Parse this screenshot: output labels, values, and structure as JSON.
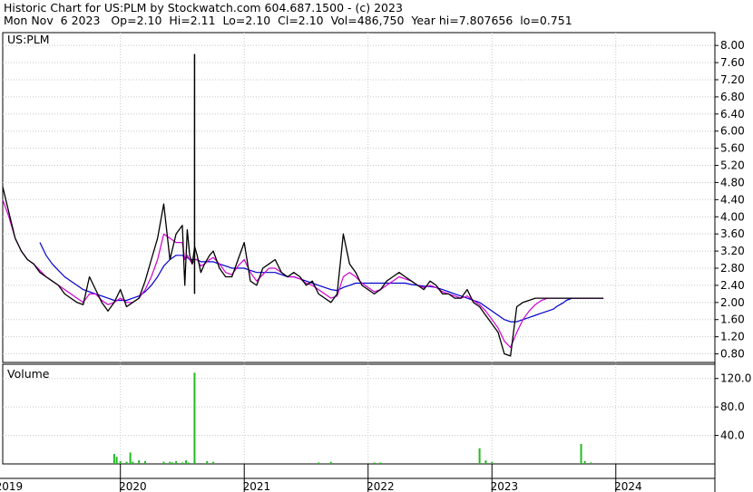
{
  "header": {
    "line1": "Historic Chart for US:PLM by Stockwatch.com 604.687.1500 - (c) 2023",
    "line2": "Mon Nov  6 2023   Op=2.10  Hi=2.11  Lo=2.10  Cl=2.10  Vol=486,750  Year hi=7.807656  lo=0.751"
  },
  "colors": {
    "price": "#000000",
    "ma_short": "#d000d0",
    "ma_long": "#0000cc",
    "volume": "#22bb22",
    "grid": "#c8c8c8"
  },
  "chart_data": [
    {
      "type": "line",
      "name_label": "US:PLM",
      "ylim": [
        0.6,
        8.3
      ],
      "y_ticks": [
        "0.80",
        "1.20",
        "1.60",
        "2.00",
        "2.40",
        "2.80",
        "3.20",
        "3.60",
        "4.00",
        "4.40",
        "4.80",
        "5.20",
        "5.60",
        "6.00",
        "6.40",
        "6.80",
        "7.20",
        "7.60",
        "8.00"
      ],
      "x_range": [
        2018.55,
        2024.3
      ],
      "x": [
        2018.55,
        2018.6,
        2018.65,
        2018.7,
        2018.75,
        2018.8,
        2018.85,
        2018.9,
        2018.95,
        2019.0,
        2019.05,
        2019.1,
        2019.15,
        2019.2,
        2019.25,
        2019.3,
        2019.35,
        2019.4,
        2019.45,
        2019.5,
        2019.55,
        2019.6,
        2019.65,
        2019.7,
        2019.75,
        2019.8,
        2019.85,
        2019.9,
        2019.95,
        2020.0,
        2020.02,
        2020.04,
        2020.06,
        2020.08,
        2020.1,
        2020.12,
        2020.15,
        2020.18,
        2020.2,
        2020.22,
        2020.25,
        2020.3,
        2020.35,
        2020.4,
        2020.45,
        2020.5,
        2020.55,
        2020.6,
        2020.65,
        2020.7,
        2020.75,
        2020.8,
        2020.85,
        2020.9,
        2020.95,
        2021.0,
        2021.05,
        2021.1,
        2021.15,
        2021.2,
        2021.25,
        2021.3,
        2021.35,
        2021.4,
        2021.45,
        2021.5,
        2021.55,
        2021.6,
        2021.65,
        2021.7,
        2021.75,
        2021.8,
        2021.85,
        2021.9,
        2021.95,
        2022.0,
        2022.05,
        2022.1,
        2022.15,
        2022.2,
        2022.25,
        2022.3,
        2022.35,
        2022.4,
        2022.45,
        2022.5,
        2022.55,
        2022.6,
        2022.65,
        2022.7,
        2022.75,
        2022.8,
        2022.85,
        2022.9,
        2022.95,
        2023.0,
        2023.02,
        2023.05,
        2023.08,
        2023.1,
        2023.13,
        2023.15,
        2023.18,
        2023.2,
        2023.25,
        2023.3,
        2023.35,
        2023.4
      ],
      "series": [
        {
          "key": "price",
          "values": [
            4.7,
            4.1,
            3.5,
            3.2,
            3.0,
            2.9,
            2.7,
            2.6,
            2.5,
            2.4,
            2.2,
            2.1,
            2.0,
            1.95,
            2.6,
            2.3,
            2.0,
            1.8,
            2.0,
            2.3,
            1.9,
            2.0,
            2.1,
            2.5,
            3.0,
            3.5,
            4.3,
            3.0,
            3.6,
            3.8,
            2.4,
            3.7,
            3.1,
            2.9,
            3.3,
            3.1,
            2.7,
            2.9,
            3.0,
            3.1,
            3.2,
            2.8,
            2.6,
            2.6,
            3.0,
            3.4,
            2.5,
            2.4,
            2.8,
            2.9,
            3.0,
            2.7,
            2.6,
            2.7,
            2.6,
            2.4,
            2.5,
            2.2,
            2.1,
            2.0,
            2.2,
            3.6,
            2.9,
            2.7,
            2.4,
            2.3,
            2.2,
            2.3,
            2.5,
            2.6,
            2.7,
            2.6,
            2.5,
            2.4,
            2.3,
            2.5,
            2.4,
            2.2,
            2.2,
            2.1,
            2.1,
            2.3,
            2.0,
            1.9,
            1.7,
            1.5,
            1.3,
            0.8,
            0.75,
            1.9,
            2.0,
            2.05,
            2.1,
            2.1,
            2.1,
            2.1,
            2.1,
            2.1,
            2.1,
            2.1,
            2.1,
            2.1,
            2.1,
            2.1,
            2.1,
            2.1,
            2.1,
            2.1
          ]
        },
        {
          "key": "ma_short",
          "values": [
            4.4,
            4.0,
            3.5,
            3.2,
            3.0,
            2.9,
            2.75,
            2.6,
            2.5,
            2.4,
            2.3,
            2.2,
            2.1,
            2.0,
            2.2,
            2.2,
            2.05,
            1.95,
            2.0,
            2.1,
            2.0,
            2.0,
            2.1,
            2.3,
            2.6,
            3.0,
            3.6,
            3.5,
            3.4,
            3.4,
            3.0,
            3.1,
            3.0,
            2.9,
            3.0,
            3.0,
            2.85,
            2.9,
            2.95,
            3.0,
            3.05,
            2.9,
            2.7,
            2.65,
            2.85,
            3.0,
            2.7,
            2.5,
            2.65,
            2.8,
            2.8,
            2.7,
            2.6,
            2.6,
            2.55,
            2.45,
            2.4,
            2.3,
            2.2,
            2.1,
            2.15,
            2.6,
            2.7,
            2.6,
            2.45,
            2.35,
            2.25,
            2.3,
            2.4,
            2.5,
            2.6,
            2.55,
            2.5,
            2.4,
            2.35,
            2.4,
            2.35,
            2.25,
            2.2,
            2.15,
            2.1,
            2.15,
            2.05,
            1.95,
            1.8,
            1.6,
            1.4,
            1.1,
            0.95,
            1.3,
            1.6,
            1.8,
            1.95,
            2.05,
            2.1,
            2.1,
            2.1,
            2.1,
            2.1,
            2.1,
            2.1,
            2.1,
            2.1,
            2.1,
            2.1,
            2.1,
            2.1,
            2.1
          ]
        },
        {
          "key": "ma_long",
          "values": [
            null,
            null,
            null,
            null,
            null,
            null,
            3.4,
            3.1,
            2.9,
            2.75,
            2.6,
            2.5,
            2.4,
            2.3,
            2.25,
            2.2,
            2.15,
            2.1,
            2.05,
            2.05,
            2.05,
            2.1,
            2.15,
            2.25,
            2.4,
            2.6,
            2.85,
            3.0,
            3.1,
            3.1,
            3.05,
            3.05,
            3.0,
            3.0,
            3.0,
            3.0,
            2.95,
            2.95,
            2.95,
            2.95,
            2.95,
            2.9,
            2.85,
            2.8,
            2.8,
            2.8,
            2.75,
            2.7,
            2.7,
            2.7,
            2.7,
            2.65,
            2.6,
            2.6,
            2.55,
            2.5,
            2.45,
            2.4,
            2.35,
            2.3,
            2.28,
            2.35,
            2.4,
            2.45,
            2.45,
            2.45,
            2.45,
            2.45,
            2.45,
            2.45,
            2.45,
            2.45,
            2.42,
            2.4,
            2.38,
            2.37,
            2.35,
            2.3,
            2.25,
            2.2,
            2.15,
            2.1,
            2.05,
            2.0,
            1.9,
            1.8,
            1.7,
            1.6,
            1.55,
            1.55,
            1.6,
            1.65,
            1.7,
            1.75,
            1.8,
            1.85,
            1.9,
            1.95,
            2.0,
            2.05,
            2.08,
            2.1,
            2.1,
            2.1,
            2.1,
            2.1,
            2.1,
            2.1
          ]
        }
      ]
    },
    {
      "type": "bar",
      "name_label": "Volume",
      "ylim": [
        0,
        140
      ],
      "y_ticks": [
        "40.0",
        "80.0",
        "120.0"
      ],
      "x": [
        2019.45,
        2019.47,
        2019.5,
        2019.55,
        2019.58,
        2019.6,
        2019.65,
        2019.7,
        2019.85,
        2019.9,
        2019.92,
        2019.95,
        2020.0,
        2020.03,
        2020.05,
        2020.1,
        2020.2,
        2020.25,
        2021.1,
        2021.2,
        2021.55,
        2021.6,
        2022.4,
        2022.45,
        2022.5,
        2023.22,
        2023.25,
        2023.3
      ],
      "values": [
        14,
        10,
        4,
        3,
        16,
        3,
        5,
        4,
        3,
        3,
        2,
        4,
        2,
        5,
        2,
        3,
        4,
        3,
        2,
        3,
        2,
        2,
        22,
        5,
        3,
        28,
        4,
        2
      ],
      "spike": {
        "x": 2019.63,
        "value": 128
      }
    }
  ],
  "price_label": "US:PLM",
  "volume_label": "Volume",
  "x_axis": {
    "years": [
      "2019",
      "2020",
      "2021",
      "2022",
      "2023",
      "2024"
    ],
    "year_centers": [
      2019.0,
      2020.0,
      2021.0,
      2022.0,
      2023.0,
      2024.0
    ]
  }
}
